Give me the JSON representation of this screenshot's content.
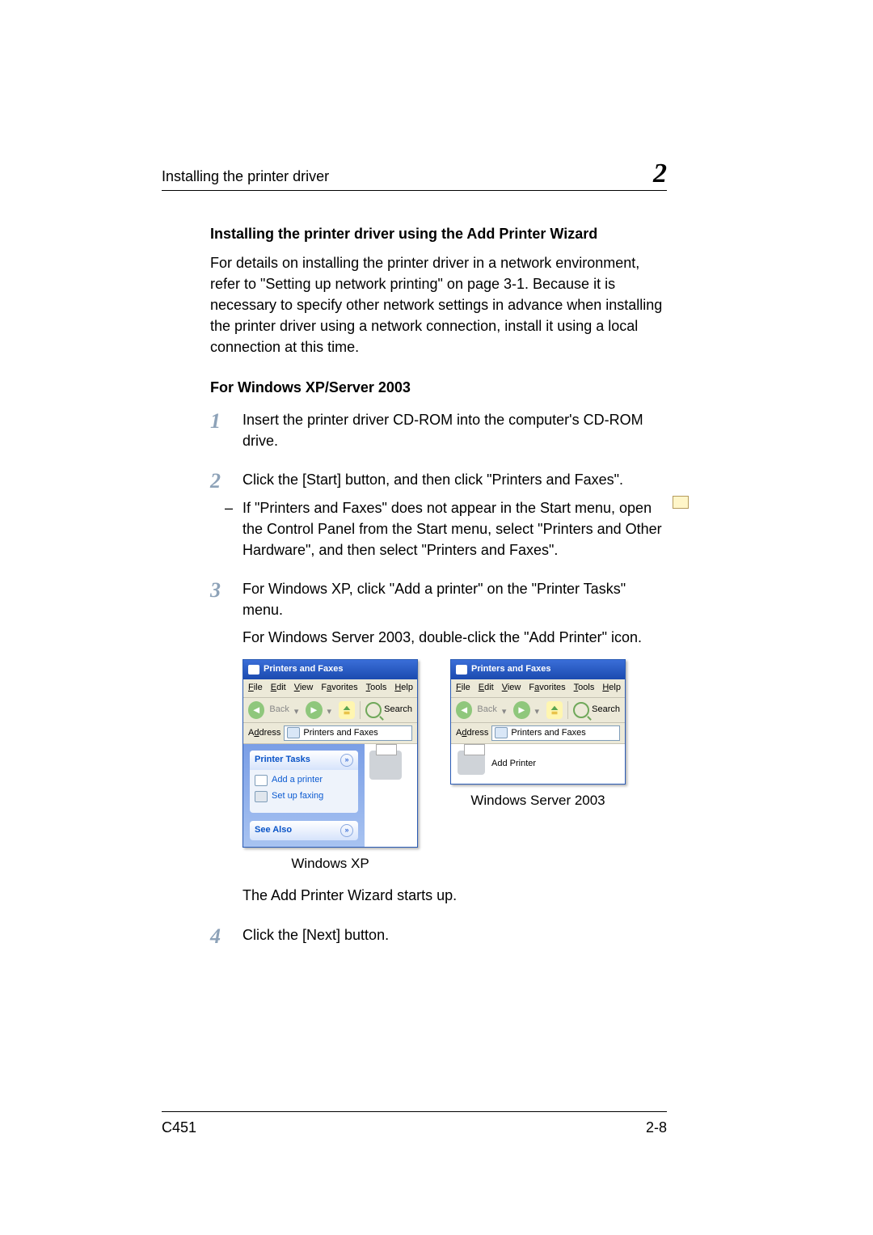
{
  "header": {
    "title": "Installing the printer driver",
    "chapter_number": "2"
  },
  "section_title": "Installing the printer driver using the Add Printer Wizard",
  "intro_para": "For details on installing the printer driver in a network environment, refer to \"Setting up network printing\" on page 3-1. Because it is necessary to specify other network settings in advance when installing the printer driver using a network connection, install it using a local connection at this time.",
  "subsection_title": "For Windows XP/Server 2003",
  "steps": {
    "1": {
      "num": "1",
      "text": "Insert the printer driver CD-ROM into the computer's CD-ROM drive."
    },
    "2": {
      "num": "2",
      "text": "Click the [Start] button, and then click \"Printers and Faxes\".",
      "note": "If \"Printers and Faxes\" does not appear in the Start menu, open the Control Panel from the Start menu, select \"Printers and Other Hardware\", and then select \"Printers and Faxes\"."
    },
    "3": {
      "num": "3",
      "line1": "For Windows XP, click \"Add a printer\" on the \"Printer Tasks\" menu.",
      "line2": "For Windows Server 2003, double-click the \"Add Printer\" icon.",
      "after": "The Add Printer Wizard starts up."
    },
    "4": {
      "num": "4",
      "text": "Click the [Next] button."
    }
  },
  "screenshots": {
    "xp": {
      "window_title": "Printers and Faxes",
      "menu": {
        "file": "File",
        "edit": "Edit",
        "view": "View",
        "favorites": "Favorites",
        "tools": "Tools",
        "help": "Help"
      },
      "toolbar": {
        "back": "Back",
        "search": "Search"
      },
      "addr_label": "Address",
      "addr_value": "Printers and Faxes",
      "tasks_header": "Printer Tasks",
      "task_add": "Add a printer",
      "task_fax": "Set up faxing",
      "see_also": "See Also",
      "caption": "Windows XP"
    },
    "srv": {
      "window_title": "Printers and Faxes",
      "menu": {
        "file": "File",
        "edit": "Edit",
        "view": "View",
        "favorites": "Favorites",
        "tools": "Tools",
        "help": "Help"
      },
      "toolbar": {
        "back": "Back",
        "search": "Search"
      },
      "addr_label": "Address",
      "addr_value": "Printers and Faxes",
      "item_label": "Add Printer",
      "caption": "Windows Server 2003"
    }
  },
  "footer": {
    "model": "C451",
    "page": "2-8"
  }
}
